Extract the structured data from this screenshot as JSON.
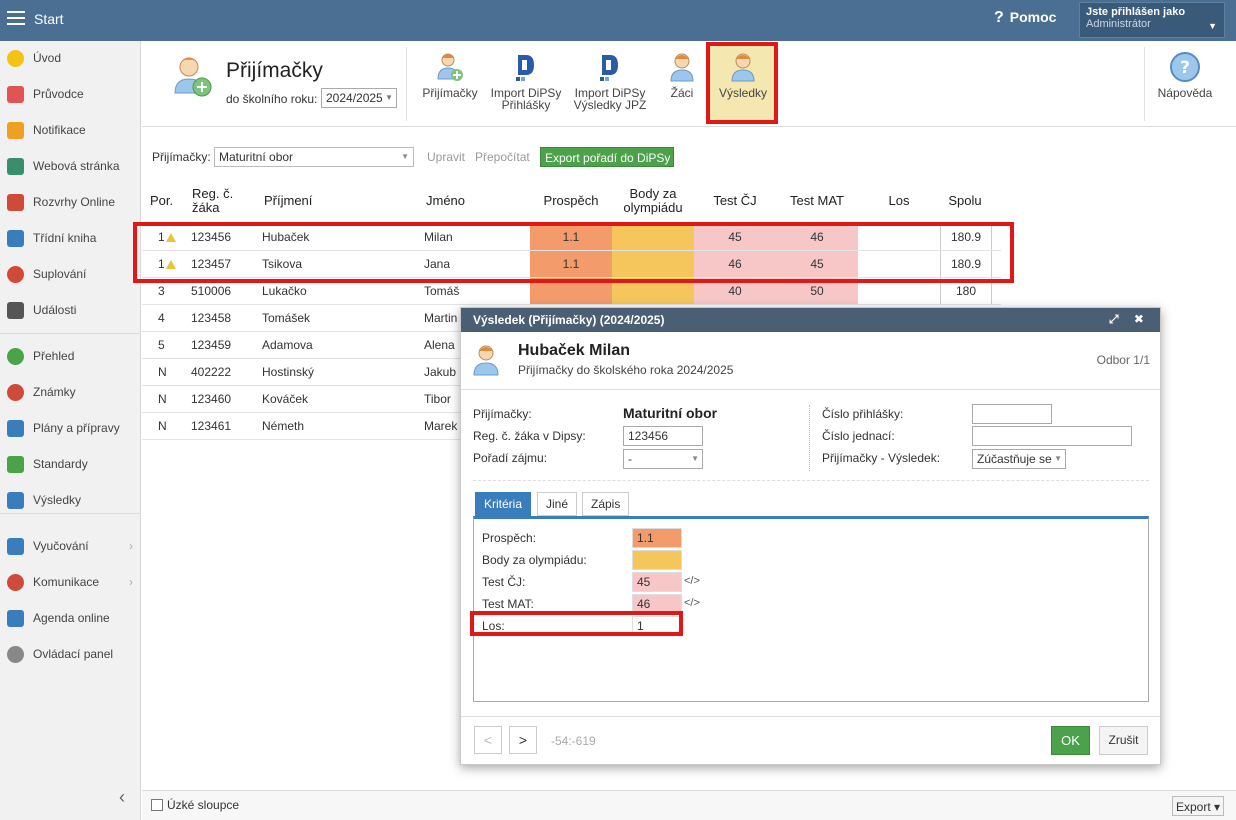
{
  "topbar": {
    "start_label": "Start",
    "help_label": "Pomoc",
    "user_line1": "Jste přihlášen jako",
    "user_line2": "Administrátor"
  },
  "sidebar": {
    "items": [
      {
        "label": "Úvod",
        "icon": "star-icon",
        "color": "#f2c316"
      },
      {
        "label": "Průvodce",
        "icon": "wand-icon",
        "color": "#e05454"
      },
      {
        "label": "Notifikace",
        "icon": "envelope-icon",
        "color": "#f0a020"
      },
      {
        "label": "Webová stránka",
        "icon": "home-icon",
        "color": "#3a8f6a"
      },
      {
        "label": "Rozvrhy Online",
        "icon": "calendar-icon",
        "color": "#d04a3a"
      },
      {
        "label": "Třídní kniha",
        "icon": "book-icon",
        "color": "#3a7dbd"
      },
      {
        "label": "Suplování",
        "icon": "person-icon",
        "color": "#d04a3a"
      },
      {
        "label": "Události",
        "icon": "calendar-grid-icon",
        "color": "#555555"
      },
      {
        "label": "Přehled",
        "icon": "check-circle-icon",
        "color": "#4ba24b"
      },
      {
        "label": "Známky",
        "icon": "grade-icon",
        "color": "#d04a3a"
      },
      {
        "label": "Plány a přípravy",
        "icon": "briefcase-icon",
        "color": "#3a7dbd"
      },
      {
        "label": "Standardy",
        "icon": "shield-icon",
        "color": "#4ba24b"
      },
      {
        "label": "Výsledky",
        "icon": "bar-chart-icon",
        "color": "#3a7dbd"
      },
      {
        "label": "Vyučování",
        "icon": "open-book-icon",
        "color": "#3a7dbd"
      },
      {
        "label": "Komunikace",
        "icon": "chat-icon",
        "color": "#d04a3a"
      },
      {
        "label": "Agenda online",
        "icon": "pencil-icon",
        "color": "#3a7dbd"
      },
      {
        "label": "Ovládací panel",
        "icon": "gear-icon",
        "color": "#888888"
      }
    ]
  },
  "toolbar": {
    "title": "Přijímačky",
    "year_label": "do školního roku:",
    "year_value": "2024/2025",
    "buttons": [
      {
        "label1": "Přijímačky",
        "label2": ""
      },
      {
        "label1": "Import DiPSy",
        "label2": "Přihlášky"
      },
      {
        "label1": "Import DiPSy",
        "label2": "Výsledky JPZ"
      },
      {
        "label1": "Žáci",
        "label2": ""
      },
      {
        "label1": "Výsledky",
        "label2": ""
      }
    ],
    "help_label": "Nápověda"
  },
  "filter": {
    "label": "Přijímačky:",
    "value": "Maturitní obor",
    "edit": "Upravit",
    "recalc": "Přepočítat",
    "export": "Export pořadí do DiPSy"
  },
  "table": {
    "headers": {
      "por": "Por.",
      "reg1": "Reg. č.",
      "reg2": "žáka",
      "prijmeni": "Příjmení",
      "jmeno": "Jméno",
      "prospech": "Prospěch",
      "body1": "Body za",
      "body2": "olympiádu",
      "testcj": "Test ČJ",
      "testmat": "Test MAT",
      "los": "Los",
      "spolu": "Spolu"
    },
    "rows": [
      {
        "por": "1",
        "warn": true,
        "reg": "123456",
        "prijmeni": "Hubaček",
        "jmeno": "Milan",
        "prospech": "1.1",
        "testcj": "45",
        "testmat": "46",
        "spolu": "180.9"
      },
      {
        "por": "1",
        "warn": true,
        "reg": "123457",
        "prijmeni": "Tsikova",
        "jmeno": "Jana",
        "prospech": "1.1",
        "testcj": "46",
        "testmat": "45",
        "spolu": "180.9"
      },
      {
        "por": "3",
        "warn": false,
        "reg": "510006",
        "prijmeni": "Lukačko",
        "jmeno": "Tomáš",
        "prospech": "",
        "testcj": "40",
        "testmat": "50",
        "spolu": "180"
      },
      {
        "por": "4",
        "warn": false,
        "reg": "123458",
        "prijmeni": "Tomášek",
        "jmeno": "Martin",
        "prospech": "",
        "testcj": "",
        "testmat": "",
        "spolu": ""
      },
      {
        "por": "5",
        "warn": false,
        "reg": "123459",
        "prijmeni": "Adamova",
        "jmeno": "Alena",
        "prospech": "",
        "testcj": "",
        "testmat": "",
        "spolu": ""
      },
      {
        "por": "N",
        "warn": false,
        "reg": "402222",
        "prijmeni": "Hostinský",
        "jmeno": "Jakub",
        "prospech": "",
        "testcj": "",
        "testmat": "",
        "spolu": ""
      },
      {
        "por": "N",
        "warn": false,
        "reg": "123460",
        "prijmeni": "Kováček",
        "jmeno": "Tibor",
        "prospech": "",
        "testcj": "",
        "testmat": "",
        "spolu": ""
      },
      {
        "por": "N",
        "warn": false,
        "reg": "123461",
        "prijmeni": "Németh",
        "jmeno": "Marek",
        "prospech": "",
        "testcj": "",
        "testmat": "",
        "spolu": ""
      }
    ]
  },
  "bottom": {
    "narrow_label": "Úzké sloupce",
    "export_label": "Export ▾"
  },
  "dialog": {
    "title": "Výsledek (Přijímačky) (2024/2025)",
    "controls": "⤢ ✖",
    "name": "Hubaček Milan",
    "subtitle": "Přijímačky do školského roka 2024/2025",
    "odbor": "Odbor 1/1",
    "fields": {
      "prijimacky_label": "Přijímačky:",
      "prijimacky_value": "Maturitní obor",
      "reg_label": "Reg. č. žáka v Dipsy:",
      "reg_value": "123456",
      "poradi_label": "Pořadí zájmu:",
      "poradi_value": "-",
      "cislo_prihl_label": "Číslo přihlášky:",
      "cislo_prihl_value": "",
      "cislo_jedn_label": "Číslo jednací:",
      "cislo_jedn_value": "",
      "vysledek_label": "Přijímačky - Výsledek:",
      "vysledek_value": "Zúčastňuje se"
    },
    "tabs": [
      "Kritéria",
      "Jiné",
      "Zápis"
    ],
    "criteria": [
      {
        "label": "Prospěch:",
        "value": "1.1",
        "bg": "#f39b6a",
        "code": ""
      },
      {
        "label": "Body za olympiádu:",
        "value": "",
        "bg": "#f5c65c",
        "code": ""
      },
      {
        "label": "Test ČJ:",
        "value": "45",
        "bg": "#f7c7c7",
        "code": "</>"
      },
      {
        "label": "Test MAT:",
        "value": "46",
        "bg": "#f7c7c7",
        "code": "</>"
      },
      {
        "label": "Los:",
        "value": "1",
        "bg": "#ffffff",
        "code": ""
      }
    ],
    "prev": "<",
    "next": ">",
    "range": "-54:-619",
    "ok": "OK",
    "cancel": "Zrušit"
  }
}
